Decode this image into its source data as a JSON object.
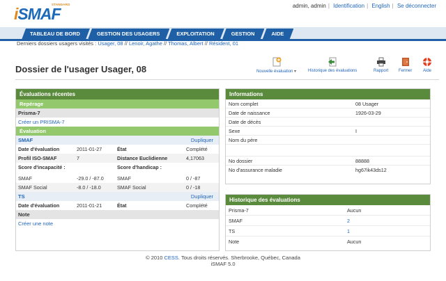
{
  "header": {
    "logo_standard": "STANDARD",
    "logo_i": "i",
    "logo_rest": "SMAF",
    "user": "admin, admin",
    "links": [
      "Identification",
      "English",
      "Se déconnecter"
    ]
  },
  "nav": {
    "tabs": [
      "TABLEAU DE BORD",
      "GESTION DES USAGERS",
      "EXPLOITATION",
      "GESTION",
      "AIDE"
    ]
  },
  "recent": {
    "label": "Derniers dossiers usagers visités :",
    "items": [
      "Usager, 08",
      "Lenoir, Agathe",
      "Thomas, Albert",
      "Résident, 01"
    ],
    "sep": "//"
  },
  "page": {
    "title": "Dossier de l'usager Usager, 08"
  },
  "toolbar": {
    "new_eval": "Nouvelle évaluation",
    "history": "Historique des évaluations",
    "report": "Rapport",
    "close": "Fermer",
    "help": "Aide",
    "colors": {
      "new": "#f0a020",
      "history": "#3a8a3a",
      "report": "#444444",
      "close": "#c0562a",
      "help": "#e04020"
    }
  },
  "evaluations": {
    "title": "Évaluations récentes",
    "reperage": "Repérage",
    "prisma": "Prisma-7",
    "create_prisma": "Créer un PRISMA-7",
    "evaluation": "Évaluation",
    "smaf": {
      "name": "SMAF",
      "action": "Dupliquer",
      "date_label": "Date d'évaluation",
      "date": "2011-01-27",
      "state_label": "État",
      "state": "Complété",
      "profile_label": "Profil ISO-SMAF",
      "profile": "7",
      "distance_label": "Distance Euclidienne",
      "distance": "4,17063",
      "incap_label": "Score d'incapacité :",
      "handicap_label": "Score d'handicap :",
      "rows": [
        [
          "SMAF",
          "-29.0 / -87.0",
          "SMAF",
          "0 / -87"
        ],
        [
          "SMAF Social",
          "-8.0 / -18.0",
          "SMAF Social",
          "0 / -18"
        ]
      ]
    },
    "ts": {
      "name": "TS",
      "action": "Dupliquer",
      "date_label": "Date d'évaluation",
      "date": "2011-01-21",
      "state_label": "État",
      "state": "Complété"
    },
    "note": "Note",
    "create_note": "Créer une note"
  },
  "info": {
    "title": "Informations",
    "rows": [
      [
        "Nom complet",
        "08 Usager"
      ],
      [
        "Date de naissance",
        "1926-03-29"
      ],
      [
        "Date de décès",
        ""
      ],
      [
        "Sexe",
        "I"
      ],
      [
        "Nom du père",
        ""
      ],
      [
        "",
        ""
      ],
      [
        "No dossier",
        "88888"
      ],
      [
        "No d'assurance maladie",
        "hg67ik43ds12"
      ]
    ]
  },
  "history": {
    "title": "Historique des évaluations",
    "rows": [
      [
        "Prisma-7",
        "Aucun"
      ],
      [
        "SMAF",
        "2"
      ],
      [
        "TS",
        "1"
      ],
      [
        "Note",
        "Aucun"
      ]
    ]
  },
  "footer": {
    "pre": "© 2010",
    "org": "CESS",
    "post": ". Tous droits réservés. Sherbrooke, Québec, Canada",
    "version": "iSMAF 5.0"
  }
}
